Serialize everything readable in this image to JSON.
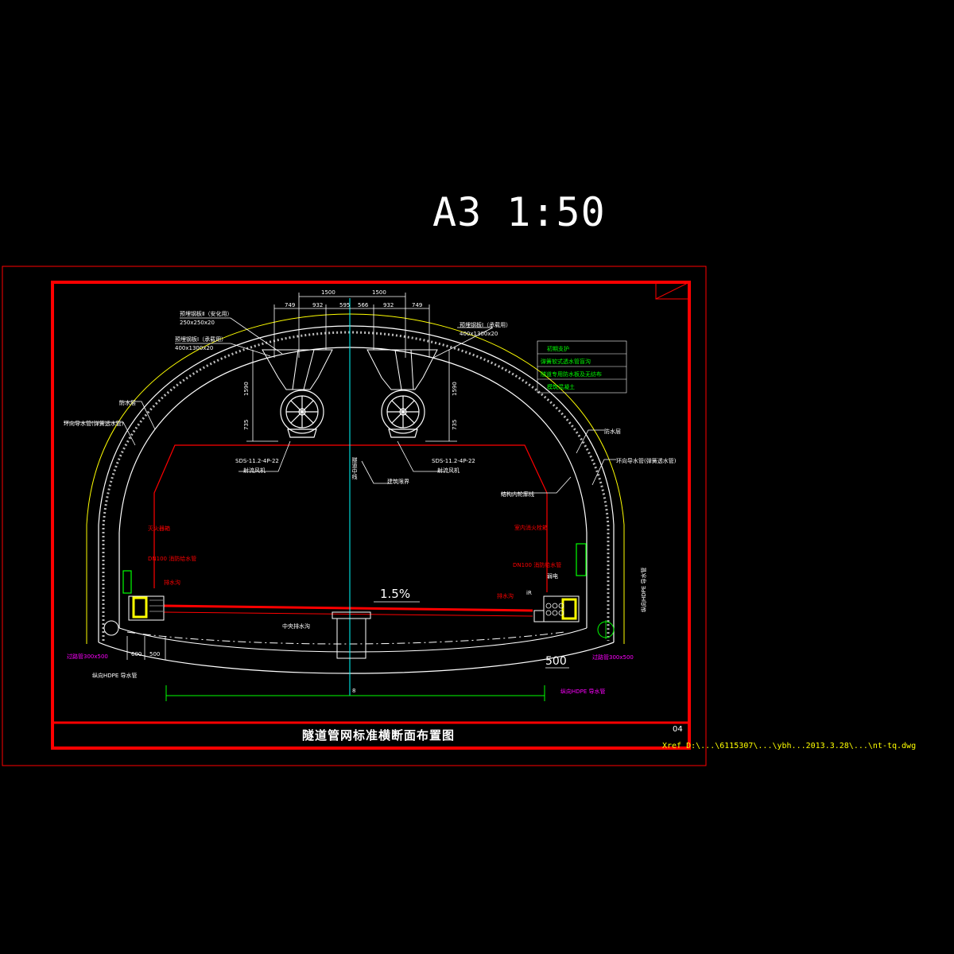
{
  "header": {
    "scale_label": "A3 1:50"
  },
  "title_block": {
    "title": "隧道管网标准横断面布置图",
    "sheet_no": "04"
  },
  "xref_path": "Xref D:\\...\\6115307\\...\\ybh...2013.3.28\\...\\nt-tq.dwg",
  "dimensions": {
    "top_1500_left": "1500",
    "top_1500_right": "1500",
    "d749_l": "749",
    "d932_l": "932",
    "d595_l": "595",
    "d566_r": "566",
    "d932_r": "932",
    "d749_r": "749",
    "fan_h_l": "1590",
    "fan_h_r": "1590",
    "fan_low_l": "735",
    "fan_low_r": "735",
    "d600": "600",
    "d500": "500",
    "d500_big": "500",
    "bottom_total": "8",
    "slope": "1.5%"
  },
  "labels": {
    "steel_plate_2": "预埋钢板Ⅱ（安化用）",
    "steel_plate_2_size": "250x250x20",
    "steel_plate_1_left": "预埋钢板Ⅰ（承载用）",
    "steel_plate_1_left_size": "400x1300x20",
    "steel_plate_1_right": "预埋钢板Ⅰ（承载用）",
    "steel_plate_1_right_size": "400x1300x20",
    "waterproof_left": "防水层",
    "waterproof_right": "防水层",
    "drain_pipe_left": "环向导水管(弹簧透水管)",
    "drain_pipe_right": "环向导水管(弹簧透水管)",
    "fan_model_left": "SDS-11.2-4P-22",
    "fan_model_right": "SDS-11.2-4P-22",
    "fan_name_left": "射流风机",
    "fan_name_right": "射流风机",
    "tunnel_center": "隧道中线",
    "building_limit": "建筑限界",
    "lining": "结构内轮廓线",
    "extinguisher": "灭火器箱",
    "fire_pipe_left": "DN100 消防给水管",
    "drain_left": "排水沟",
    "hydrant_box": "室内消火栓箱",
    "fire_pipe_right": "DN100 消防给水管",
    "cable_trench": "电缆沟",
    "weak_current": "弱电",
    "water_sump": "排水沟",
    "center_ditch": "中央排水沟",
    "longitudinal_left": "纵向HDPE 导水管",
    "longitudinal_right": "纵向HDPE 导水管",
    "side_longitudinal": "纵向HDPE 导水管",
    "bottom_pipe_left": "过路管300x500",
    "bottom_pipe_right": "过路管300x500",
    "fill_i": "iR"
  },
  "legend": {
    "items": [
      "初期支护",
      "弹簧软式透水管盲沟",
      "隧道专用防水板及无纺布",
      "模筑混凝土"
    ]
  }
}
